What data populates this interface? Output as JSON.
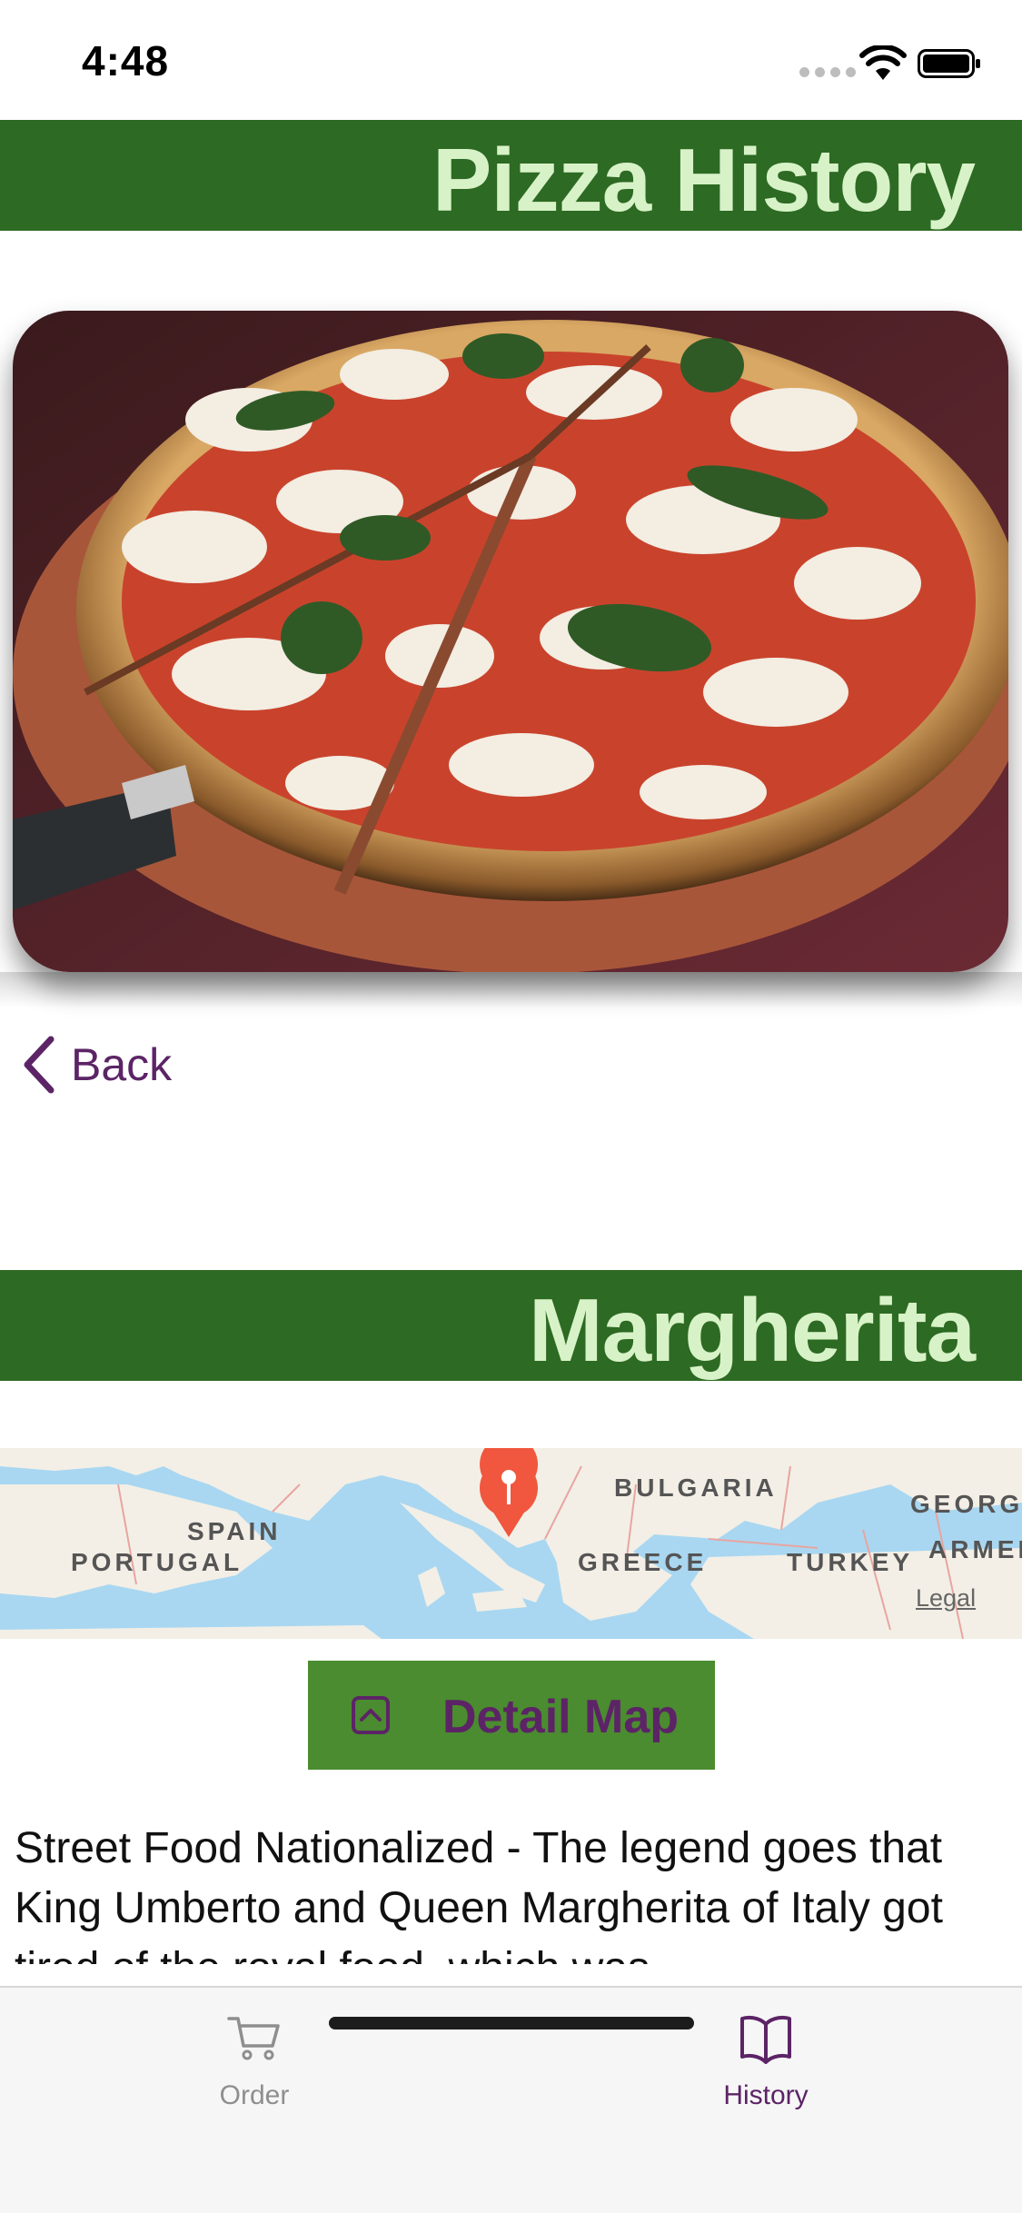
{
  "status_bar": {
    "time": "4:48"
  },
  "header": {
    "title": "Pizza History"
  },
  "hero": {
    "image": "margherita-pizza-photo"
  },
  "nav": {
    "back_label": "Back"
  },
  "pizza": {
    "name": "Margherita"
  },
  "map": {
    "labels": [
      "SPAIN",
      "PORTUGAL",
      "BULGARIA",
      "GREECE",
      "TURKEY",
      "GEORGI",
      "ARMEN"
    ],
    "legal": "Legal",
    "pin_color": "#f0573e"
  },
  "detail_button": {
    "label": "Detail Map",
    "icon": "chevron-up-square-icon"
  },
  "description": "Street Food Nationalized - The legend goes that King Umberto and Queen Margherita of Italy got tired of the royal food, which was",
  "tabs": [
    {
      "label": "Order",
      "icon": "cart-icon",
      "selected": false
    },
    {
      "label": "History",
      "icon": "book-icon",
      "selected": true
    }
  ],
  "colors": {
    "banner": "#2d6a23",
    "banner_text": "#d8f2c8",
    "accent": "#5c2466",
    "button": "#4a8c2f",
    "tab_inactive": "#8e8e8e"
  }
}
